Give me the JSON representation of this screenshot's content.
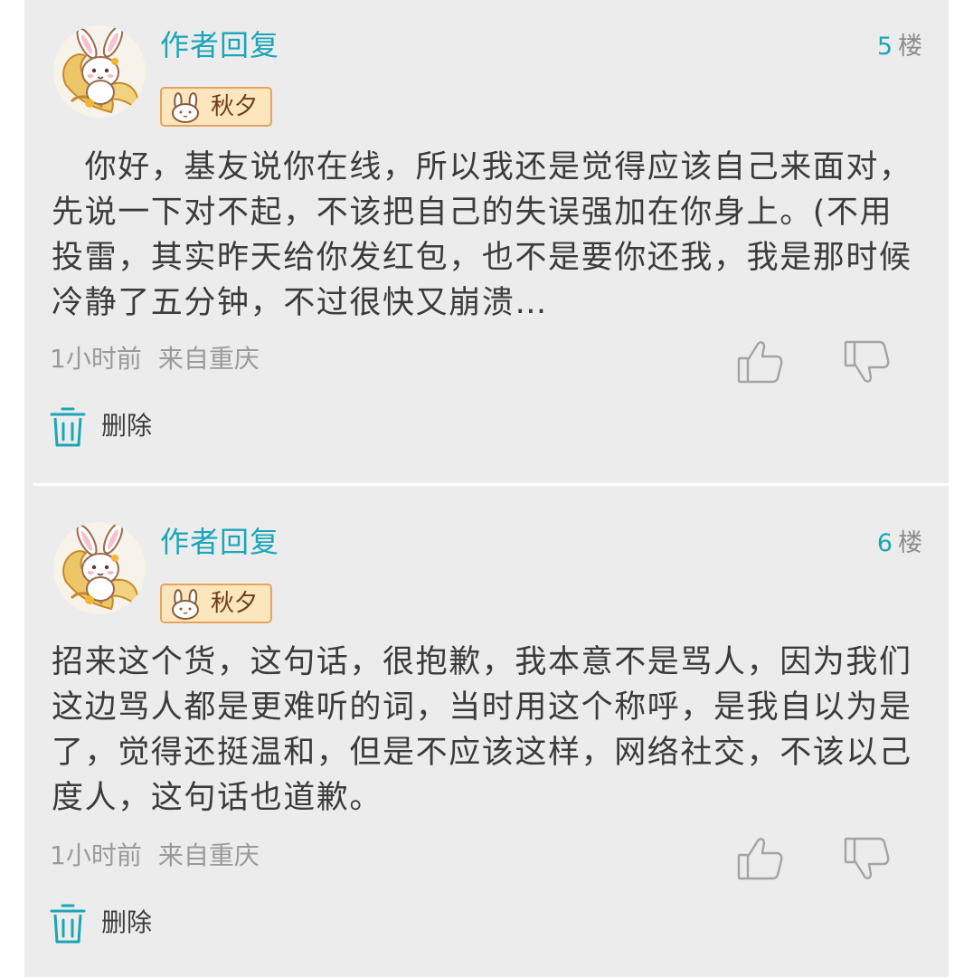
{
  "replies": [
    {
      "author": "作者回复",
      "floor_number": "5",
      "floor_unit": "楼",
      "badge": "秋夕",
      "content": "　你好，基友说你在线，所以我还是觉得应该自己来面对，先说一下对不起，不该把自己的失误强加在你身上。(不用投雷，其实昨天给你发红包，也不是要你还我，我是那时候冷静了五分钟，不过很快又崩溃…",
      "time": "1小时前",
      "location": "来自重庆",
      "delete_label": "删除",
      "icons": {
        "avatar": "rabbit-avatar",
        "badge": "rabbit-icon",
        "like": "thumbs-up-icon",
        "dislike": "thumbs-down-icon",
        "delete": "trash-icon"
      }
    },
    {
      "author": "作者回复",
      "floor_number": "6",
      "floor_unit": "楼",
      "badge": "秋夕",
      "content": "招来这个货，这句话，很抱歉，我本意不是骂人，因为我们这边骂人都是更难听的词，当时用这个称呼，是我自以为是了，觉得还挺温和，但是不应该这样，网络社交，不该以己度人，这句话也道歉。",
      "time": "1小时前",
      "location": "来自重庆",
      "delete_label": "删除",
      "icons": {
        "avatar": "rabbit-avatar",
        "badge": "rabbit-icon",
        "like": "thumbs-up-icon",
        "dislike": "thumbs-down-icon",
        "delete": "trash-icon"
      }
    }
  ],
  "colors": {
    "accent": "#1aa6b8",
    "panel_background": "#ececec",
    "text": "#3b3b3b",
    "meta_text": "#9a9a9a",
    "badge_fill": "#fde5bd",
    "badge_border": "#e5a45d"
  }
}
